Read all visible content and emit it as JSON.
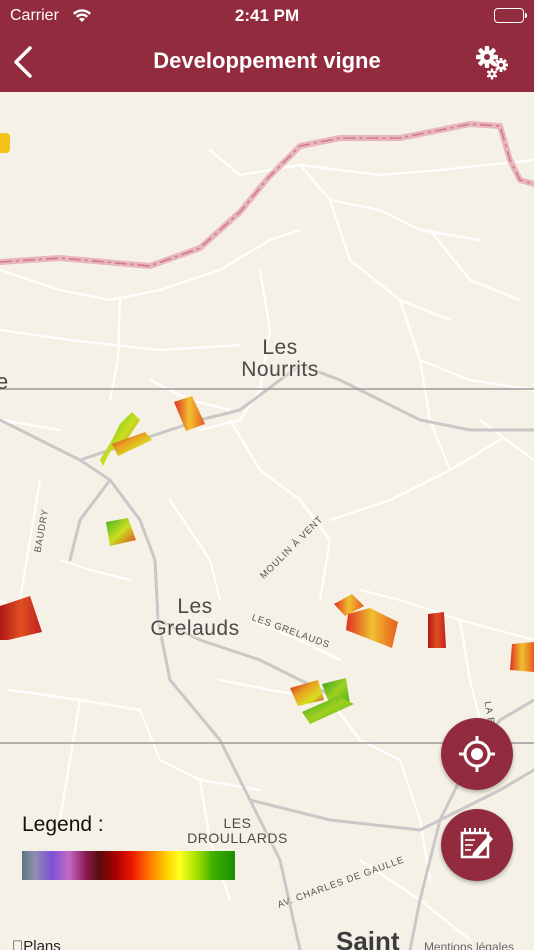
{
  "status_bar": {
    "carrier": "Carrier",
    "time": "2:41 PM"
  },
  "nav": {
    "title": "Developpement vigne"
  },
  "map": {
    "places": {
      "nourrits": "Les\nNourrits",
      "grelauds": "Les\nGrelauds",
      "droullards": "LES\nDROULLARDS"
    },
    "roads": {
      "baudry": "BAUDRY",
      "moulin": "MOULIN À VENT",
      "les_grelauds": "LES GRELAUDS",
      "charles": "AV. CHARLES DE GAULLE",
      "la_bo": "LA BO"
    },
    "partial_town": "Saint",
    "left_edge_e": "e",
    "attribution": "Plans",
    "mentions": "Mentions légales"
  },
  "legend": {
    "title": "Legend :"
  },
  "colors": {
    "brand": "#922b3e",
    "map_bg": "#f5f1e6"
  },
  "icons": {
    "back": "chevron-left-icon",
    "settings": "gears-icon",
    "locate": "crosshair-icon",
    "edit": "notepad-pencil-icon"
  }
}
